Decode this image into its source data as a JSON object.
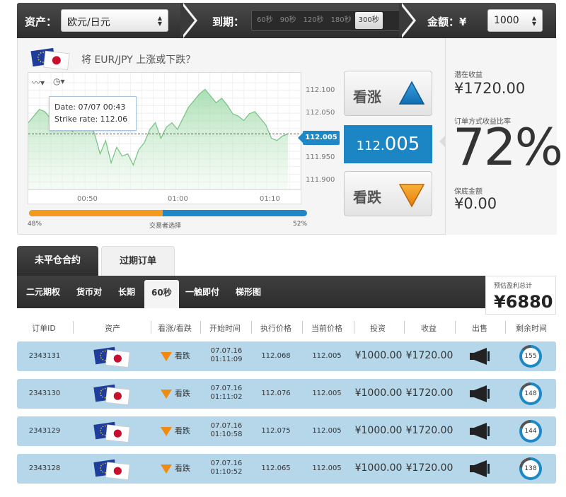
{
  "topbar": {
    "asset_label": "资产：",
    "asset_value": "欧元/日元",
    "expiry_label": "到期：",
    "expiry_options": [
      "60秒",
      "90秒",
      "120秒",
      "180秒",
      "300秒"
    ],
    "expiry_active": "300秒",
    "amount_label": "金额：¥",
    "amount_value": "1000"
  },
  "panel": {
    "question": "将 EUR/JPY 上涨或下跌？",
    "tooltip_date": "Date: 07/07 00:43",
    "tooltip_strike": "Strike rate: 112.06",
    "price_tag": "112.005",
    "call_label": "看涨",
    "put_label": "看跌",
    "current_price_big": "112.",
    "current_price_small": "005",
    "progress_left": "48%",
    "progress_mid": "交易者选择",
    "progress_right": "52%",
    "progress_fraction": 0.48
  },
  "chart_data": {
    "type": "area",
    "y_ticks": [
      "112.100",
      "112.050",
      "112.000",
      "111.950",
      "111.900"
    ],
    "x_ticks": [
      "00:50",
      "01:00",
      "01:10"
    ],
    "ylim": [
      111.88,
      112.12
    ],
    "strike": 112.005,
    "values": [
      112.03,
      112.045,
      112.06,
      112.055,
      112.04,
      112.045,
      112.05,
      112.035,
      112.01,
      112.03,
      112.04,
      112.035,
      112.005,
      111.96,
      111.99,
      111.94,
      111.975,
      111.955,
      111.96,
      111.935,
      111.97,
      111.985,
      112.015,
      112.03,
      111.995,
      112.02,
      112.03,
      112.015,
      112.04,
      112.065,
      112.08,
      112.095,
      112.105,
      112.09,
      112.075,
      112.085,
      112.07,
      112.05,
      112.045,
      112.035,
      112.05,
      112.055,
      112.04,
      112.025,
      111.995,
      111.99,
      112.0,
      112.005
    ]
  },
  "stats": {
    "potential_label": "潜在收益",
    "potential_value": "¥1720.00",
    "ratio_label": "订单方式收益比率",
    "ratio_value": "72%",
    "insured_label": "保底金额",
    "insured_value": "¥0.00"
  },
  "tabs": {
    "open": "未平仓合约",
    "expired": "过期订单"
  },
  "subtabs": [
    "二元期权",
    "货币对",
    "长期",
    "60秒",
    "一触即付",
    "梯形图"
  ],
  "subtab_active": "60秒",
  "profit": {
    "label": "预估盈利总计",
    "value": "¥6880"
  },
  "table": {
    "headers": [
      "订单ID",
      "资产",
      "看涨/看跌",
      "开始时间",
      "执行价格",
      "当前价格",
      "投资",
      "收益",
      "出售",
      "剩余时间"
    ],
    "rows": [
      {
        "id": "2343131",
        "direction": "看跌",
        "date": "07.07.16",
        "time": "01:11:09",
        "strike": "112.068",
        "current": "112.005",
        "invest": "¥1000.00",
        "payout": "¥1720.00",
        "remaining": "155"
      },
      {
        "id": "2343130",
        "direction": "看跌",
        "date": "07.07.16",
        "time": "01:11:02",
        "strike": "112.076",
        "current": "112.005",
        "invest": "¥1000.00",
        "payout": "¥1720.00",
        "remaining": "148"
      },
      {
        "id": "2343129",
        "direction": "看跌",
        "date": "07.07.16",
        "time": "01:10:58",
        "strike": "112.075",
        "current": "112.005",
        "invest": "¥1000.00",
        "payout": "¥1720.00",
        "remaining": "144"
      },
      {
        "id": "2343128",
        "direction": "看跌",
        "date": "07.07.16",
        "time": "01:10:52",
        "strike": "112.065",
        "current": "112.005",
        "invest": "¥1000.00",
        "payout": "¥1720.00",
        "remaining": "138"
      }
    ]
  },
  "colors": {
    "accent_blue": "#1e88c7",
    "accent_orange": "#f39a1f",
    "row_bg": "#b6d7ea",
    "dark_bar": "#2d2d2d"
  }
}
